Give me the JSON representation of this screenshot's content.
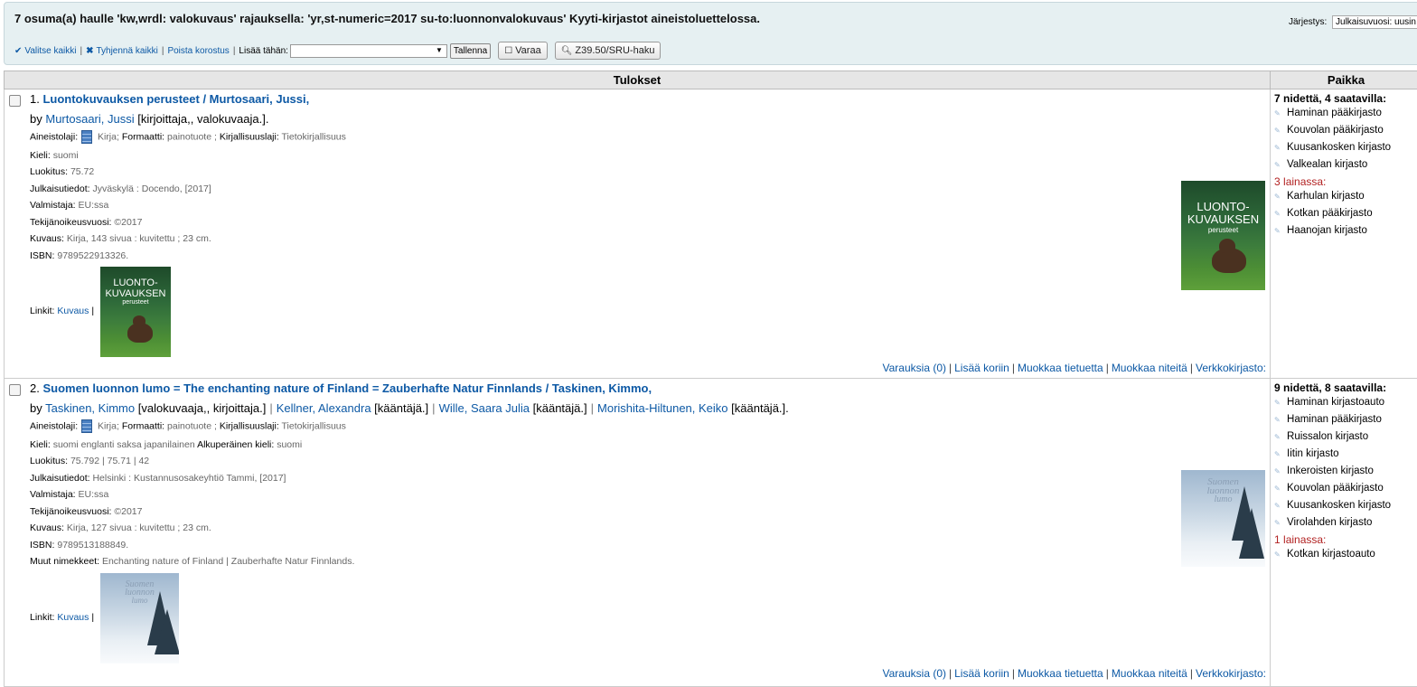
{
  "header": {
    "summary": "7 osuma(a) haulle 'kw,wrdl: valokuvaus' rajauksella: 'yr,st-numeric=2017 su-to:luonnonvalokuvaus' Kyyti-kirjastot aineistoluettelossa.",
    "sort_label": "Järjestys:",
    "sort_value": "Julkaisuvuosi: uusin"
  },
  "toolbar": {
    "select_all": "Valitse kaikki",
    "clear_all": "Tyhjennä kaikki",
    "remove_highlight": "Poista korostus",
    "add_to_label": "Lisää tähän:",
    "add_to_value": "",
    "save_label": "Tallenna",
    "hold_label": "Varaa",
    "z3950_label": "Z39.50/SRU-haku"
  },
  "table": {
    "col_results": "Tulokset",
    "col_place": "Paikka"
  },
  "records": [
    {
      "num": "1.",
      "title": "Luontokuvauksen perusteet / Murtosaari, Jussi,",
      "by": "by",
      "authors": [
        {
          "name": "Murtosaari, Jussi",
          "role": "[kirjoittaja,, valokuvaaja.]."
        }
      ],
      "type_label": "Aineistolaji:",
      "type_value": "Kirja;",
      "format_label": "Formaatti:",
      "format_value": "painotuote ;",
      "lit_label": "Kirjallisuuslaji:",
      "lit_value": "Tietokirjallisuus",
      "lang_label": "Kieli:",
      "lang_value": "suomi",
      "class_label": "Luokitus:",
      "class_value": "75.72",
      "pub_label": "Julkaisutiedot:",
      "pub_value": "Jyväskylä : Docendo, [2017]",
      "maker_label": "Valmistaja:",
      "maker_value": "EU:ssa",
      "copy_label": "Tekijänoikeusvuosi:",
      "copy_value": "©2017",
      "desc_label": "Kuvaus:",
      "desc_value": "Kirja, 143 sivua : kuvitettu ; 23 cm.",
      "isbn_label": "ISBN:",
      "isbn_value": "9789522913326.",
      "links_label": "Linkit:",
      "links_value": "Kuvaus",
      "links_sep": "|",
      "cover_text_1": "LUONTO-",
      "cover_text_2": "KUVAUKSEN",
      "cover_text_3": "perusteet",
      "actions": {
        "holds": "Varauksia (0)",
        "add_cart": "Lisää koriin",
        "edit_record": "Muokkaa tietuetta",
        "edit_items": "Muokkaa niteitä",
        "online": "Verkkokirjasto:"
      },
      "availability": {
        "head": "7 nidettä, 4 saatavilla:",
        "available": [
          "Haminan pääkirjasto",
          "Kouvolan pääkirjasto",
          "Kuusankosken kirjasto",
          "Valkealan kirjasto"
        ],
        "out_label": "3 lainassa:",
        "out": [
          "Karhulan kirjasto",
          "Kotkan pääkirjasto",
          "Haanojan kirjasto"
        ]
      }
    },
    {
      "num": "2.",
      "title": "Suomen luonnon lumo = The enchanting nature of Finland = Zauberhafte Natur Finnlands / Taskinen, Kimmo,",
      "by": "by",
      "authors": [
        {
          "name": "Taskinen, Kimmo",
          "role": "[valokuvaaja,, kirjoittaja.]"
        },
        {
          "name": "Kellner, Alexandra",
          "role": "[kääntäjä.]"
        },
        {
          "name": "Wille, Saara Julia",
          "role": "[kääntäjä.]"
        },
        {
          "name": "Morishita-Hiltunen, Keiko",
          "role": "[kääntäjä.]."
        }
      ],
      "type_label": "Aineistolaji:",
      "type_value": "Kirja;",
      "format_label": "Formaatti:",
      "format_value": "painotuote ;",
      "lit_label": "Kirjallisuuslaji:",
      "lit_value": "Tietokirjallisuus",
      "lang_label": "Kieli:",
      "lang_value": "suomi  englanti  saksa  japanilainen",
      "orig_lang_label": "Alkuperäinen kieli:",
      "orig_lang_value": "suomi",
      "class_label": "Luokitus:",
      "class_value": "75.792 | 75.71 | 42",
      "pub_label": "Julkaisutiedot:",
      "pub_value": "Helsinki : Kustannusosakeyhtiö Tammi, [2017]",
      "maker_label": "Valmistaja:",
      "maker_value": "EU:ssa",
      "copy_label": "Tekijänoikeusvuosi:",
      "copy_value": "©2017",
      "desc_label": "Kuvaus:",
      "desc_value": "Kirja, 127 sivua : kuvitettu ; 23 cm.",
      "isbn_label": "ISBN:",
      "isbn_value": "9789513188849.",
      "other_titles_label": "Muut nimekkeet:",
      "other_titles_value": "Enchanting nature of Finland  |  Zauberhafte Natur Finnlands.",
      "links_label": "Linkit:",
      "links_value": "Kuvaus",
      "links_sep": "|",
      "cover_text_1": "Suomen",
      "cover_text_2": "luonnon",
      "cover_text_3": "lumo",
      "actions": {
        "holds": "Varauksia (0)",
        "add_cart": "Lisää koriin",
        "edit_record": "Muokkaa tietuetta",
        "edit_items": "Muokkaa niteitä",
        "online": "Verkkokirjasto:"
      },
      "availability": {
        "head": "9 nidettä, 8 saatavilla:",
        "available": [
          "Haminan kirjastoauto",
          "Haminan pääkirjasto",
          "Ruissalon kirjasto",
          "Iitin kirjasto",
          "Inkeroisten kirjasto",
          "Kouvolan pääkirjasto",
          "Kuusankosken kirjasto",
          "Virolahden kirjasto"
        ],
        "out_label": "1 lainassa:",
        "out": [
          "Kotkan kirjastoauto"
        ]
      }
    }
  ]
}
